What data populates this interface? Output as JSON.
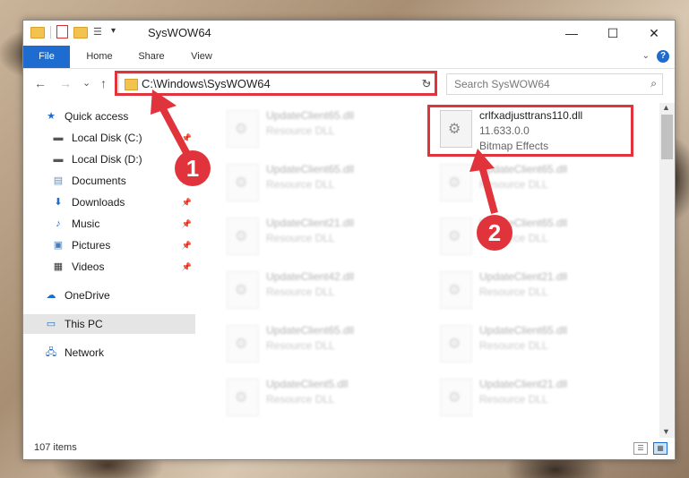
{
  "window": {
    "title": "SysWOW64",
    "controls": {
      "minimize": "—",
      "maximize": "☐",
      "close": "✕"
    }
  },
  "ribbon": {
    "tabs": [
      "File",
      "Home",
      "Share",
      "View"
    ],
    "help": "?"
  },
  "navigation": {
    "back": "←",
    "forward": "→",
    "recent": "⌄",
    "up": "↑"
  },
  "address": {
    "path": "C:\\Windows\\SysWOW64"
  },
  "search": {
    "placeholder": "Search SysWOW64"
  },
  "sidebar": {
    "items": [
      {
        "label": "Quick access",
        "icon": "star-icon"
      },
      {
        "label": "Local Disk (C:)",
        "icon": "drive-icon"
      },
      {
        "label": "Local Disk (D:)",
        "icon": "drive-icon"
      },
      {
        "label": "Documents",
        "icon": "documents-icon"
      },
      {
        "label": "Downloads",
        "icon": "download-icon"
      },
      {
        "label": "Music",
        "icon": "music-icon"
      },
      {
        "label": "Pictures",
        "icon": "pictures-icon"
      },
      {
        "label": "Videos",
        "icon": "videos-icon"
      },
      {
        "label": "OneDrive",
        "icon": "cloud-icon"
      },
      {
        "label": "This PC",
        "icon": "computer-icon"
      },
      {
        "label": "Network",
        "icon": "network-icon"
      }
    ]
  },
  "files": {
    "highlighted": {
      "name": "crlfxadjusttrans110.dll",
      "version": "11.633.0.0",
      "type": "Bitmap Effects"
    },
    "left_column": [
      {
        "name": "UpdateClient65.dll",
        "type": "Resource DLL"
      },
      {
        "name": "UpdateClient65.dll",
        "type": "Resource DLL"
      },
      {
        "name": "UpdateClient21.dll",
        "type": "Resource DLL"
      },
      {
        "name": "UpdateClient42.dll",
        "type": "Resource DLL"
      },
      {
        "name": "UpdateClient65.dll",
        "type": "Resource DLL"
      },
      {
        "name": "UpdateClient5.dll",
        "type": "Resource DLL"
      }
    ],
    "right_column": [
      {
        "name": "UpdateClient65.dll",
        "type": "Resource DLL"
      },
      {
        "name": "UpdateClient65.dll",
        "type": "Resource DLL"
      },
      {
        "name": "UpdateClient21.dll",
        "type": "Resource DLL"
      },
      {
        "name": "UpdateClient65.dll",
        "type": "Resource DLL"
      },
      {
        "name": "UpdateClient21.dll",
        "type": "Resource DLL"
      }
    ]
  },
  "annotations": {
    "step1": "1",
    "step2": "2"
  },
  "status": {
    "item_count": "107 items"
  },
  "colors": {
    "accent": "#1e6ccf",
    "highlight": "#e0333b"
  }
}
